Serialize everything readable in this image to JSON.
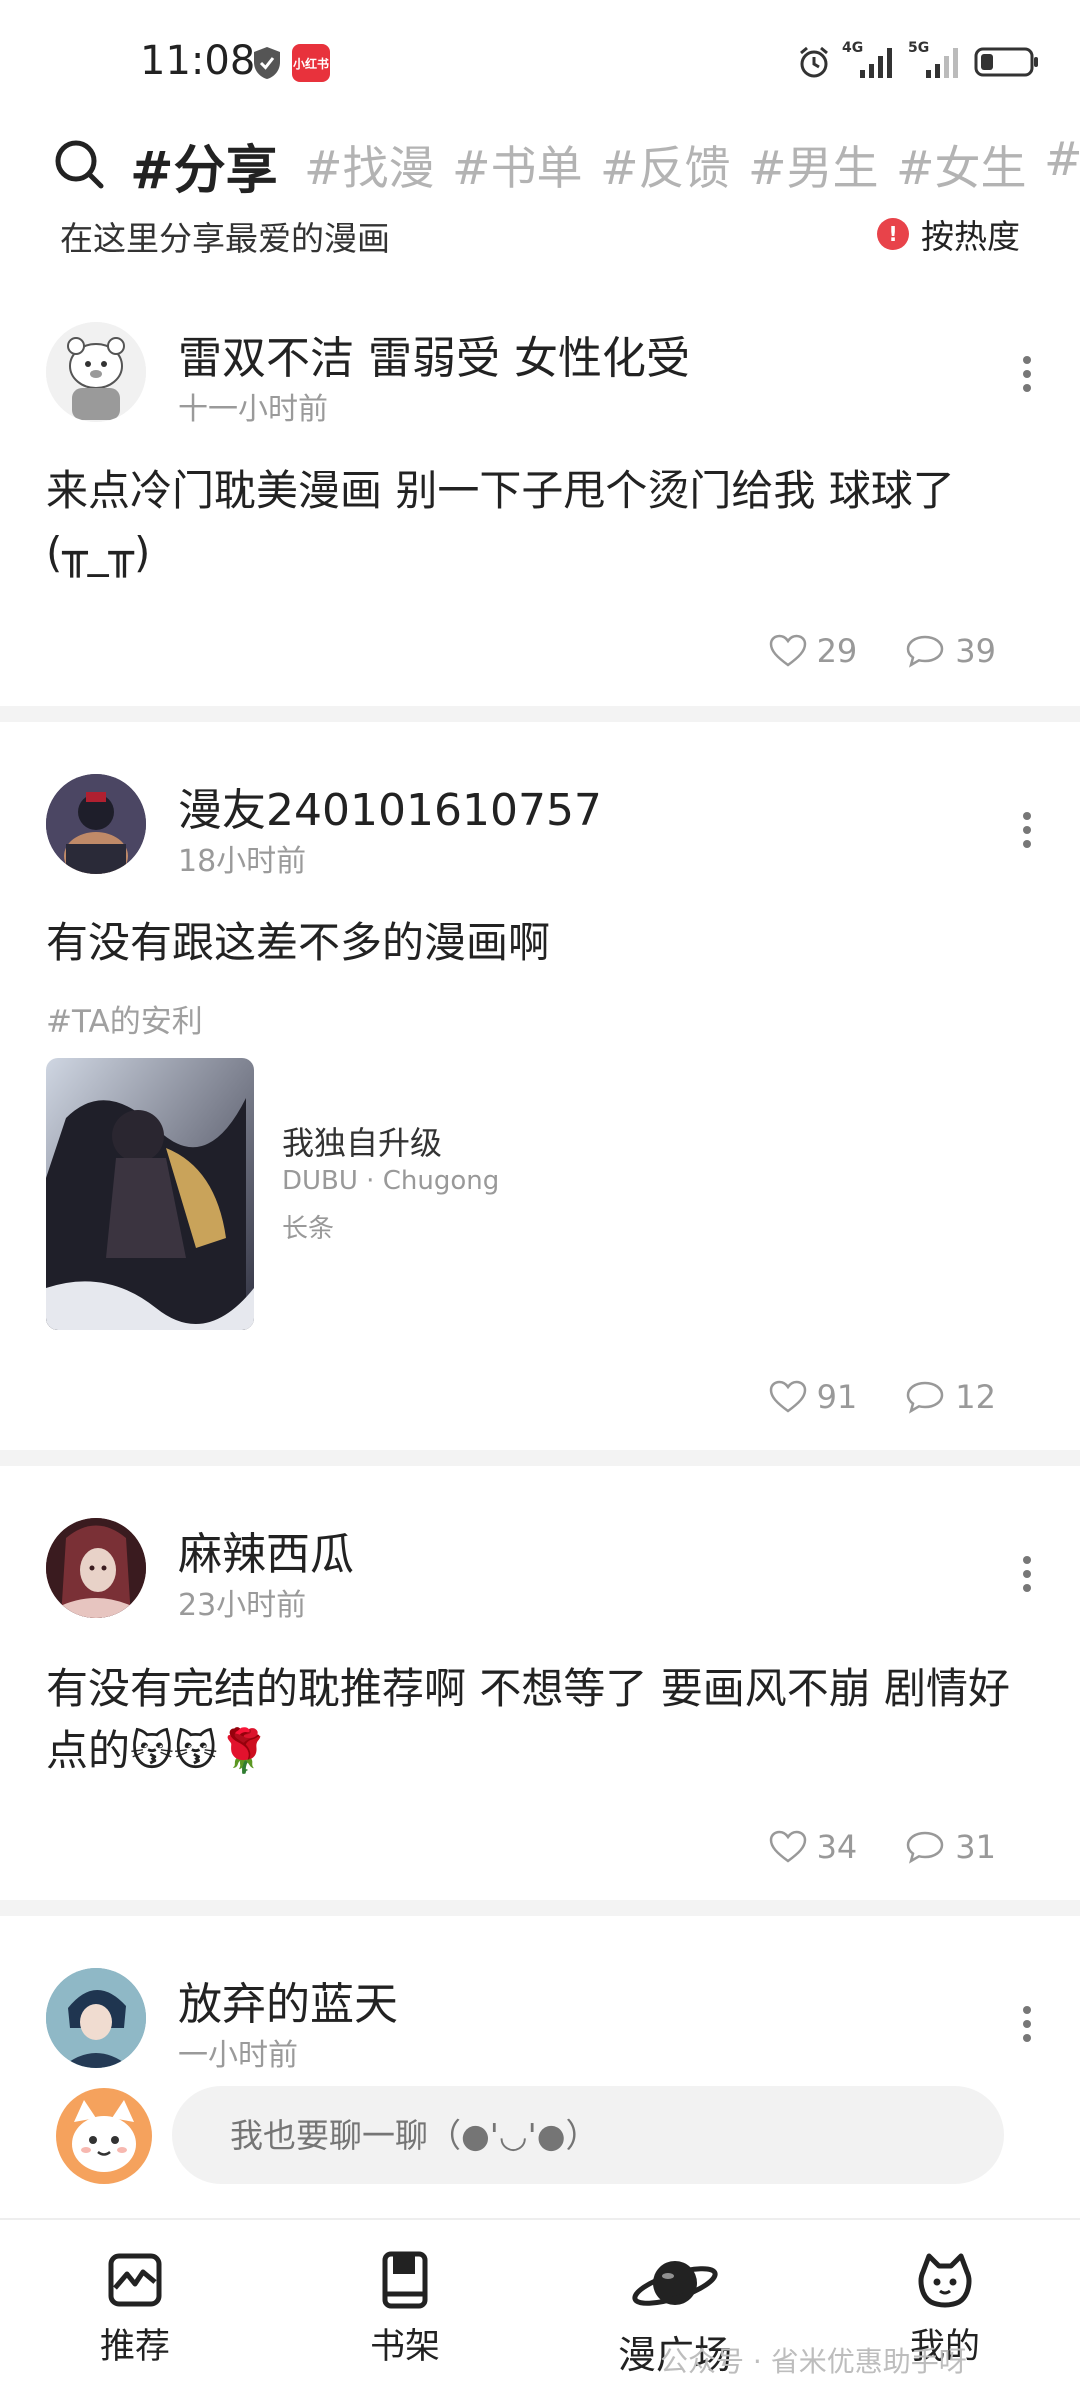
{
  "status_bar": {
    "time": "11:08",
    "app_badge": "小红书",
    "net1": "4G",
    "net2": "5G"
  },
  "tags": {
    "active": "#分享",
    "items": [
      "#找漫",
      "#书单",
      "#反馈",
      "#男生",
      "#女生",
      "#"
    ],
    "subtitle": "在这里分享最爱的漫画",
    "sort_label": "按热度"
  },
  "posts": [
    {
      "username": "雷双不洁 雷弱受 女性化受",
      "time": "十一小时前",
      "content": "来点冷门耽美漫画 别一下子甩个烫门给我 球球了(╥_╥)",
      "likes": "29",
      "comments": "39"
    },
    {
      "username": "漫友240101610757",
      "time": "18小时前",
      "content": "有没有跟这差不多的漫画啊",
      "topic": "#TA的安利",
      "book": {
        "title": "我独自升级",
        "author": "DUBU · Chugong",
        "type": "长条"
      },
      "likes": "91",
      "comments": "12"
    },
    {
      "username": "麻辣西瓜",
      "time": "23小时前",
      "content": "有没有完结的耽推荐啊 不想等了 要画风不崩 剧情好点的😽😽🌹",
      "likes": "34",
      "comments": "31"
    },
    {
      "username": "放弃的蓝天",
      "time": "一小时前"
    }
  ],
  "composer": {
    "placeholder": "我也要聊一聊（●'◡'●）"
  },
  "bottom_nav": [
    {
      "label": "推荐",
      "icon": "recommend-icon"
    },
    {
      "label": "书架",
      "icon": "bookshelf-icon"
    },
    {
      "label": "漫广场",
      "icon": "planet-icon"
    },
    {
      "label": "我的",
      "icon": "cat-face-icon"
    }
  ],
  "watermark": "公众号 · 省米优惠助手呀",
  "colors": {
    "accent_red": "#e8434a",
    "text_primary": "#222222",
    "text_secondary": "#9a9a9a",
    "divider": "#f3f3f3"
  }
}
